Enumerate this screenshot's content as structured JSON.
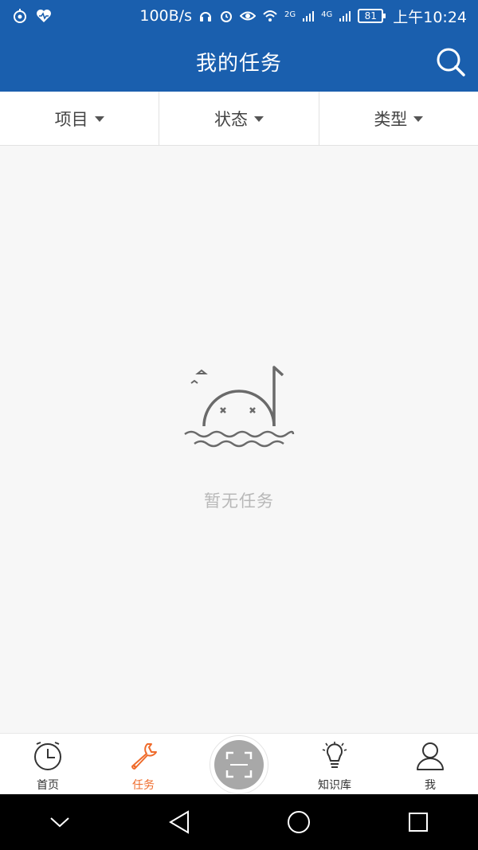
{
  "status_bar": {
    "speed": "100B/s",
    "network_2g": "2G",
    "network_4g": "4G",
    "battery": "81",
    "time": "上午10:24"
  },
  "header": {
    "title": "我的任务"
  },
  "filters": [
    {
      "label": "项目"
    },
    {
      "label": "状态"
    },
    {
      "label": "类型"
    }
  ],
  "empty_state": {
    "text": "暂无任务"
  },
  "tabs": [
    {
      "label": "首页",
      "icon": "clock-icon"
    },
    {
      "label": "任务",
      "icon": "wrench-icon"
    },
    {
      "label": "",
      "icon": "scan-icon"
    },
    {
      "label": "知识库",
      "icon": "lightbulb-icon"
    },
    {
      "label": "我",
      "icon": "user-icon"
    }
  ],
  "colors": {
    "primary": "#1a5fae",
    "accent": "#ef6b2b"
  }
}
